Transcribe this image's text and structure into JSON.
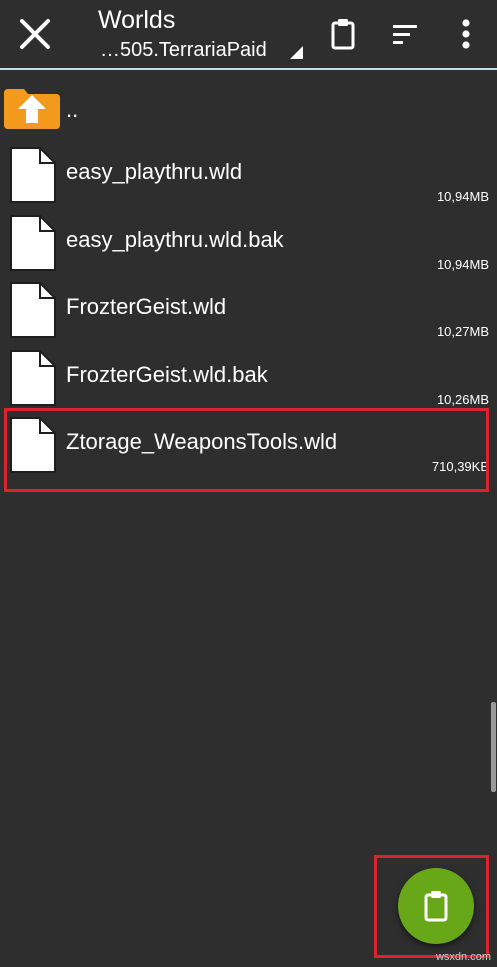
{
  "toolbar": {
    "title": "Worlds",
    "path": "…505.TerrariaPaid",
    "icons": {
      "close": "close-icon",
      "paste": "clipboard-icon",
      "sort": "sort-icon",
      "more": "more-vert-icon"
    }
  },
  "list": {
    "parent_label": "..",
    "files": [
      {
        "name": "easy_playthru.wld",
        "size": "10,94MB"
      },
      {
        "name": "easy_playthru.wld.bak",
        "size": "10,94MB"
      },
      {
        "name": "FrozterGeist.wld",
        "size": "10,27MB"
      },
      {
        "name": "FrozterGeist.wld.bak",
        "size": "10,26MB"
      },
      {
        "name": "Ztorage_WeaponsTools.wld",
        "size": "710,39KB"
      }
    ]
  },
  "fab": {
    "icon": "clipboard-icon"
  },
  "colors": {
    "background": "#2e2e2e",
    "accent_line": "#bfe3e6",
    "folder_orange": "#f39a1d",
    "fab_green": "#67a718",
    "highlight_red": "#d9232e"
  },
  "watermark": "wsxdn.com"
}
